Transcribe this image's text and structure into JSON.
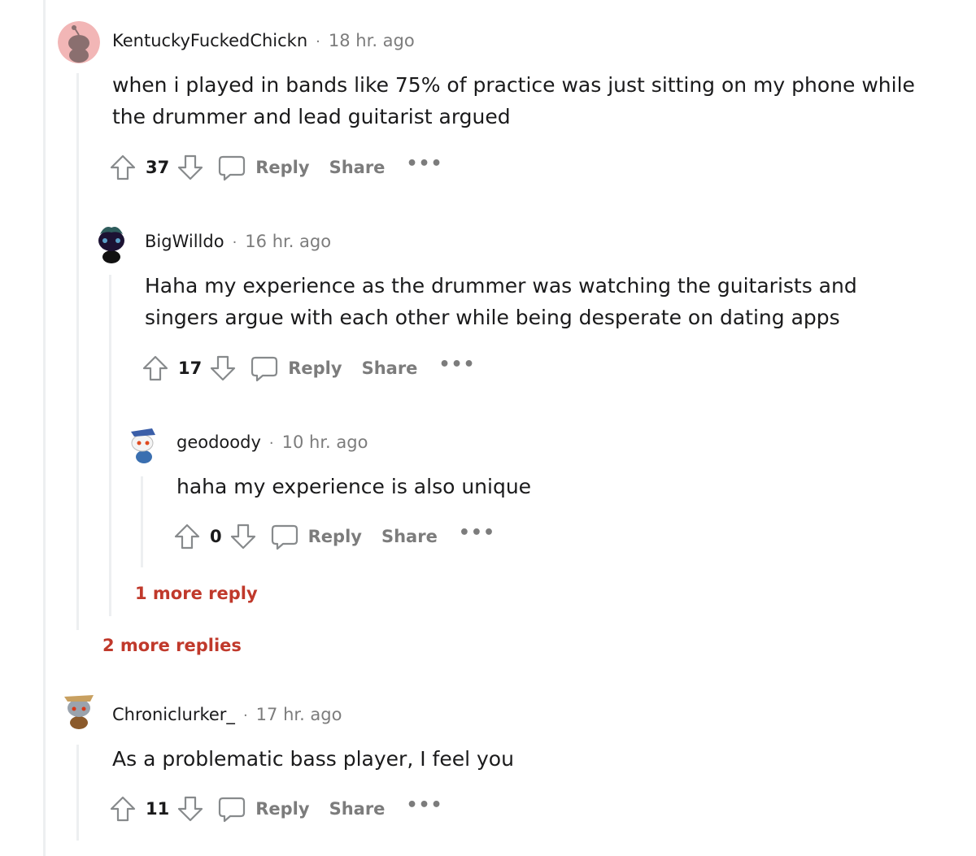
{
  "comments": [
    {
      "username": "KentuckyFuckedChickn",
      "time": "18 hr. ago",
      "body": [
        "when i played in bands like 75% of practice was just sitting on my phone while",
        "the drummer and lead guitarist argued"
      ],
      "score": "37"
    },
    {
      "username": "BigWilldo",
      "time": "16 hr. ago",
      "body": [
        "Haha my experience as the drummer was watching the guitarists and",
        "singers argue with each other while being desperate on dating apps"
      ],
      "score": "17"
    },
    {
      "username": "geodoody",
      "time": "10 hr. ago",
      "body": [
        "haha my experience is also unique"
      ],
      "score": "0"
    },
    {
      "username": "Chroniclurker_",
      "time": "17 hr. ago",
      "body": [
        "As a problematic bass player, I feel you"
      ],
      "score": "11"
    }
  ],
  "actions": {
    "reply": "Reply",
    "share": "Share",
    "more": "•••",
    "separator": "·"
  },
  "more_replies": {
    "level2": "1 more reply",
    "level1": "2 more replies"
  },
  "colors": {
    "accent_red": "#c0392b",
    "meta_gray": "#7c7c7c",
    "thread_line": "#edeff1"
  },
  "icons": [
    "upvote-icon",
    "downvote-icon",
    "comment-bubble-icon",
    "snoo-avatar-icon"
  ]
}
